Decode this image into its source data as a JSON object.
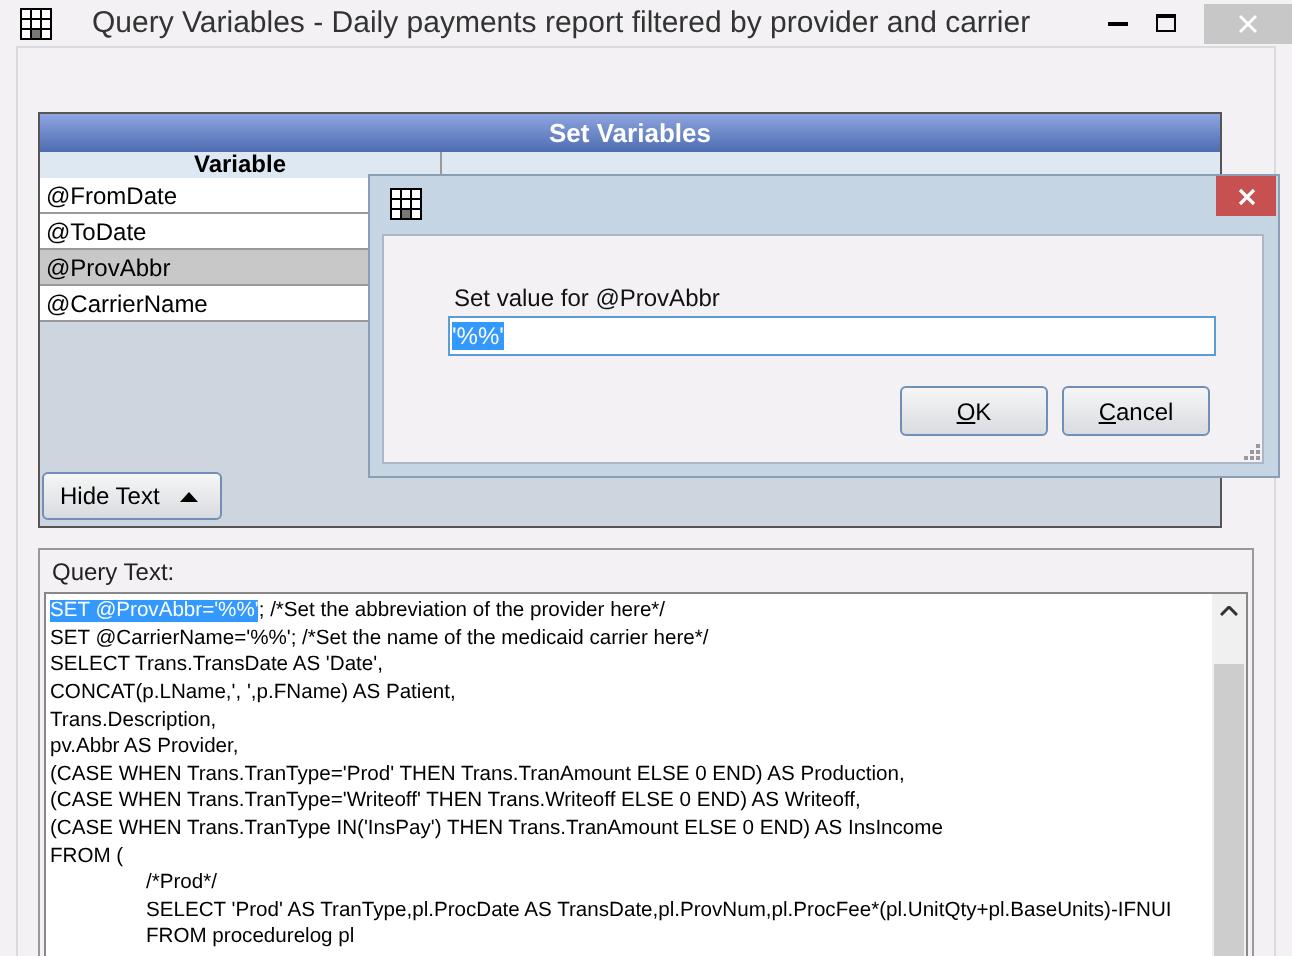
{
  "window": {
    "title": "Query Variables - Daily payments report filtered by provider and carrier"
  },
  "variables_grid": {
    "title": "Set Variables",
    "columns": [
      "Variable"
    ],
    "rows": [
      {
        "name": "@FromDate",
        "selected": false
      },
      {
        "name": "@ToDate",
        "selected": false
      },
      {
        "name": "@ProvAbbr",
        "selected": true
      },
      {
        "name": "@CarrierName",
        "selected": false
      }
    ]
  },
  "hide_text_button": {
    "label": "Hide Text"
  },
  "query_text": {
    "label": "Query Text:",
    "lines": [
      {
        "selected_text": "SET @ProvAbbr='%%'",
        "text": ";  /*Set the abbreviation of the provider here*/"
      },
      {
        "text": "SET @CarrierName='%%';  /*Set the name of the medicaid carrier here*/"
      },
      {
        "text": "SELECT Trans.TransDate AS 'Date',"
      },
      {
        "text": "CONCAT(p.LName,', ',p.FName) AS Patient,"
      },
      {
        "text": "Trans.Description,"
      },
      {
        "text": "pv.Abbr AS Provider,"
      },
      {
        "text": "(CASE WHEN Trans.TranType='Prod' THEN Trans.TranAmount ELSE 0 END) AS Production,"
      },
      {
        "text": "(CASE WHEN Trans.TranType='Writeoff' THEN Trans.Writeoff ELSE 0 END) AS Writeoff,"
      },
      {
        "text": "(CASE WHEN Trans.TranType IN('InsPay') THEN Trans.TranAmount ELSE 0 END) AS InsIncome"
      },
      {
        "text": "FROM (",
        "children": [
          {
            "text": "/*Prod*/"
          },
          {
            "text": "SELECT 'Prod' AS TranType,pl.ProcDate AS TransDate,pl.ProvNum,pl.ProcFee*(pl.UnitQty+pl.BaseUnits)-IFNUI"
          },
          {
            "text": "FROM procedurelog pl"
          }
        ]
      }
    ]
  },
  "dialog": {
    "label": "Set value for @ProvAbbr",
    "value": "'%%'",
    "buttons": [
      {
        "label": "OK"
      },
      {
        "label": "Cancel"
      }
    ]
  }
}
